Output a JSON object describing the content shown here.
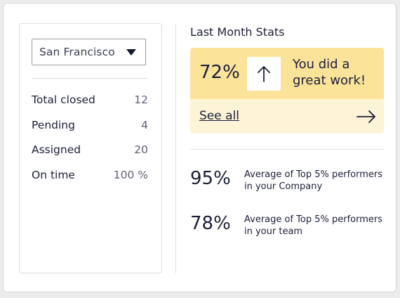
{
  "location_select": {
    "selected": "San Francisco"
  },
  "task_stats": [
    {
      "label": "Total closed",
      "value": "12"
    },
    {
      "label": "Pending",
      "value": "4"
    },
    {
      "label": "Assigned",
      "value": "20"
    },
    {
      "label": "On time",
      "value": "100 %"
    }
  ],
  "monthly_stats": {
    "title": "Last Month Stats",
    "highlight": {
      "percent": "72%",
      "message": "You did a great work!",
      "link_label": "See all"
    },
    "performance": [
      {
        "percent": "95%",
        "description": "Average of Top 5% performers in your Company"
      },
      {
        "percent": "78%",
        "description": "Average of Top 5% performers in your team"
      }
    ]
  },
  "colors": {
    "highlight_top": "#fbe39a",
    "highlight_bottom": "#fdf4d8",
    "text_primary": "#1c1f3b",
    "text_muted": "#5d6075"
  },
  "icons": {
    "dropdown": "caret-down-icon",
    "trend": "arrow-up-icon",
    "link": "arrow-right-icon"
  }
}
